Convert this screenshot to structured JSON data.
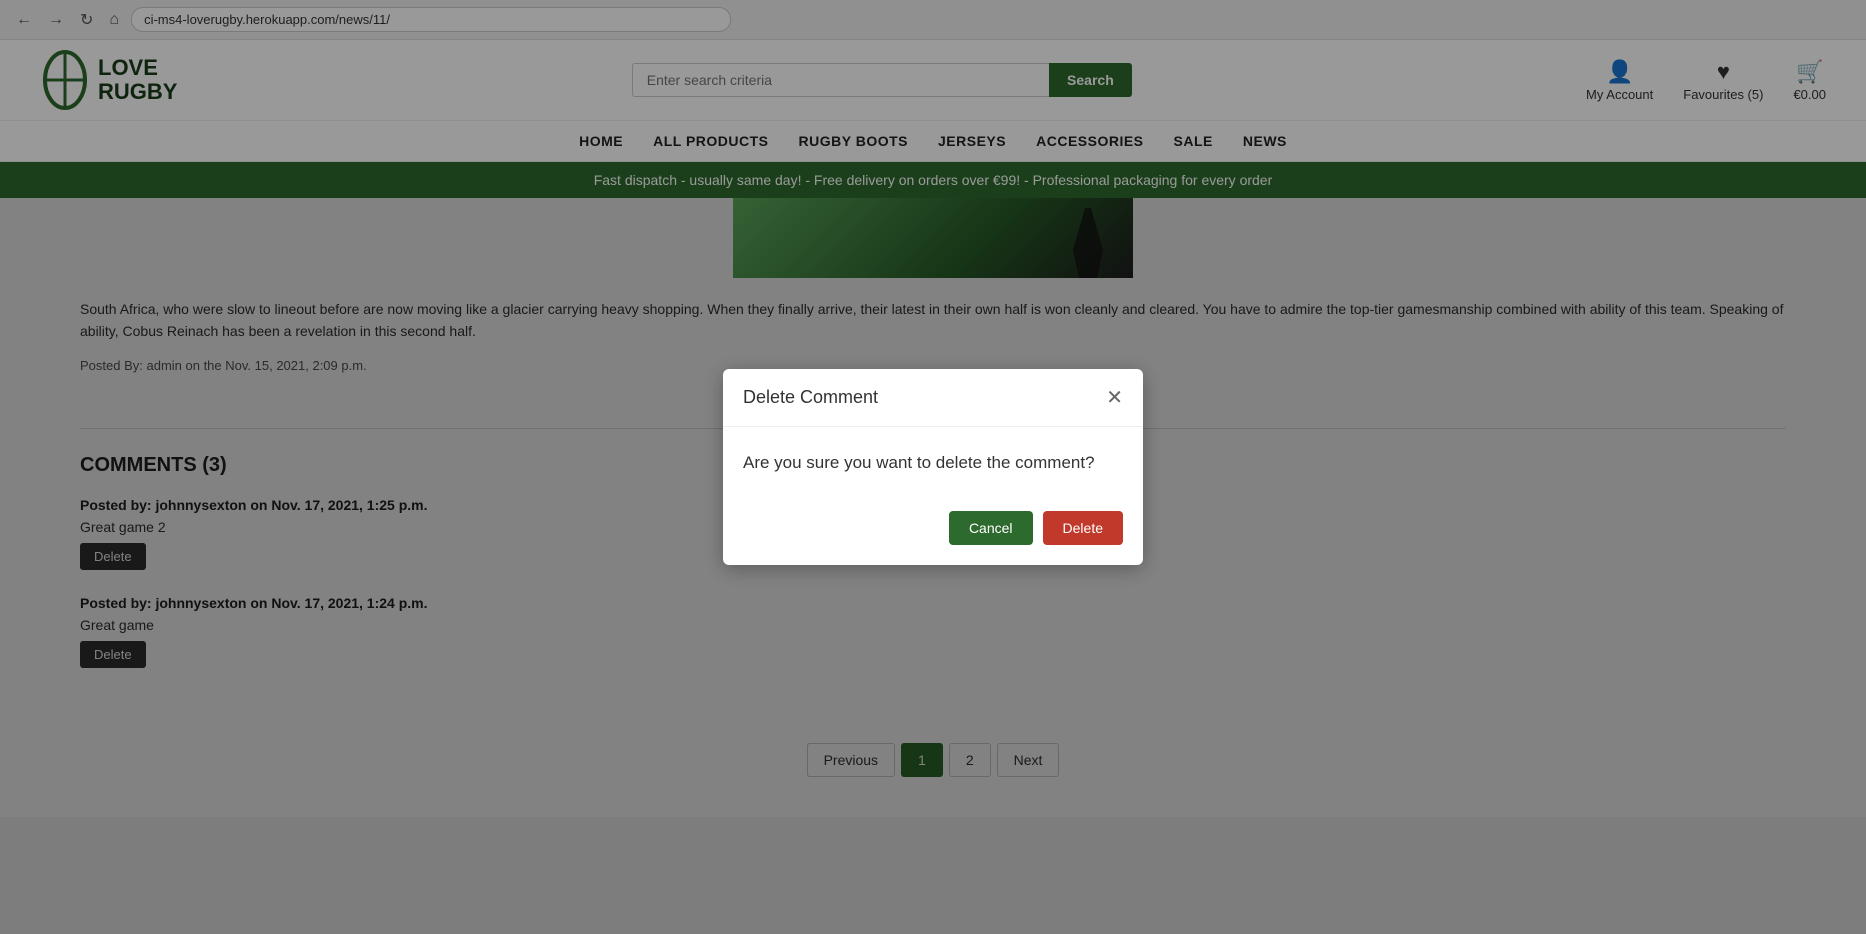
{
  "browser": {
    "url": "ci-ms4-loverugby.herokuapp.com/news/11/"
  },
  "header": {
    "logo_line1": "LOVE",
    "logo_line2": "RUGBY",
    "search_placeholder": "Enter search criteria",
    "search_button": "Search",
    "my_account_label": "My Account",
    "favourites_label": "Favourites (5)",
    "cart_label": "€0.00"
  },
  "nav": {
    "items": [
      "HOME",
      "ALL PRODUCTS",
      "RUGBY BOOTS",
      "JERSEYS",
      "ACCESSORIES",
      "SALE",
      "NEWS"
    ]
  },
  "promo_banner": {
    "text": "Fast dispatch - usually same day! - Free delivery on orders over €99! - Professional packaging for every order"
  },
  "article": {
    "body_text": "South Africa, who were slow to lineout before are now moving like a glacier carrying heavy shopping. When they finally arrive, their latest in their own half is won cleanly and cleared. You have to admire the top-tier gamesmanship combined with ability of this team. Speaking of ability, Cobus Reinach has been a revelation in this second half.",
    "posted_by": "Posted By: admin on the Nov. 15, 2021, 2:09 p.m."
  },
  "comments": {
    "heading": "COMMENTS (3)",
    "items": [
      {
        "author": "Posted by: johnnysexton on Nov. 17, 2021, 1:25 p.m.",
        "text": "Great game 2",
        "delete_label": "Delete"
      },
      {
        "author": "Posted by: johnnysexton on Nov. 17, 2021, 1:24 p.m.",
        "text": "Great game",
        "delete_label": "Delete"
      }
    ]
  },
  "pagination": {
    "previous_label": "Previous",
    "next_label": "Next",
    "current_page": "1",
    "page2": "2"
  },
  "modal": {
    "title": "Delete Comment",
    "body": "Are you sure you want to delete the comment?",
    "cancel_label": "Cancel",
    "delete_label": "Delete"
  }
}
